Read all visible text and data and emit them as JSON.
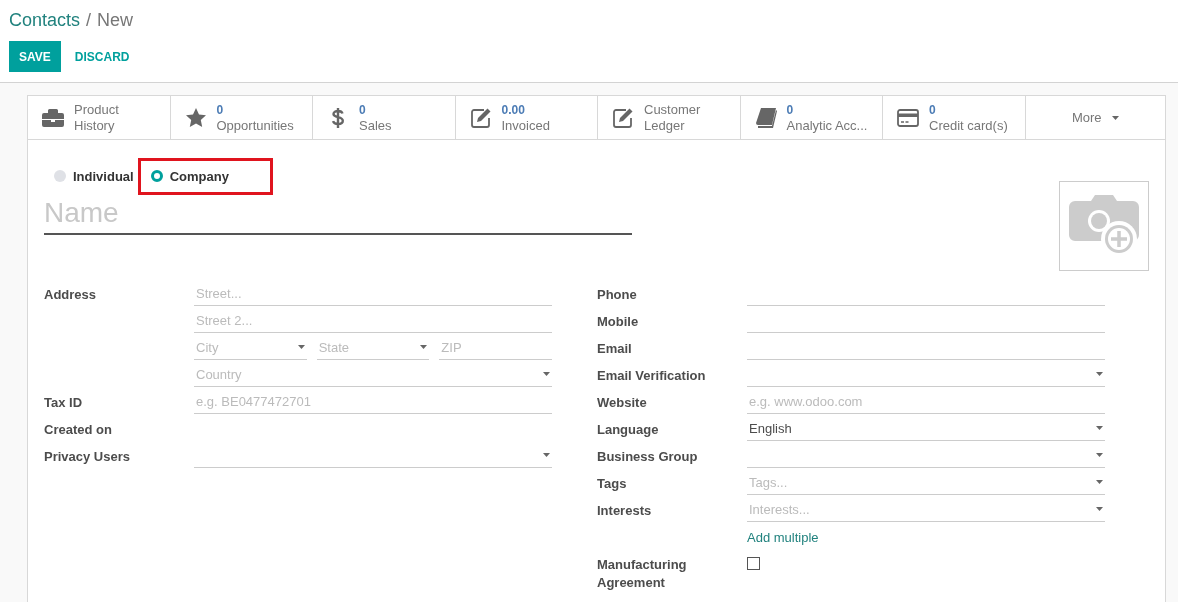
{
  "breadcrumb": {
    "parent": "Contacts",
    "separator": "/",
    "current": "New"
  },
  "buttons": {
    "save": "SAVE",
    "discard": "DISCARD"
  },
  "stat_buttons": [
    {
      "label": "Product History"
    },
    {
      "value": "0",
      "label": "Opportunities"
    },
    {
      "value": "0",
      "label": "Sales"
    },
    {
      "value": "0.00",
      "label": "Invoiced"
    },
    {
      "label": "Customer Ledger"
    },
    {
      "value": "0",
      "label": "Analytic Acc..."
    },
    {
      "value": "0",
      "label": "Credit card(s)"
    }
  ],
  "more_button": "More",
  "company_type": [
    {
      "label": "Individual",
      "selected": false,
      "highlighted": false
    },
    {
      "label": "Company",
      "selected": true,
      "highlighted": true
    }
  ],
  "name_field": {
    "placeholder": "Name"
  },
  "left_fields": [
    {
      "label": "Address",
      "lines": [
        [
          {
            "kind": "input",
            "placeholder": "Street...",
            "dropdown": false
          }
        ],
        [
          {
            "kind": "input",
            "placeholder": "Street 2...",
            "dropdown": false
          }
        ],
        [
          {
            "kind": "input",
            "placeholder": "City",
            "dropdown": true
          },
          {
            "kind": "input",
            "placeholder": "State",
            "dropdown": true
          },
          {
            "kind": "input",
            "placeholder": "ZIP",
            "dropdown": false
          }
        ],
        [
          {
            "kind": "input",
            "placeholder": "Country",
            "dropdown": true
          }
        ]
      ]
    },
    {
      "label": "Tax ID",
      "lines": [
        [
          {
            "kind": "input",
            "placeholder": "e.g. BE0477472701",
            "dropdown": false
          }
        ]
      ]
    },
    {
      "label": "Created on"
    },
    {
      "label": "Privacy Users",
      "lines": [
        [
          {
            "kind": "input",
            "dropdown": true
          }
        ]
      ]
    }
  ],
  "right_fields": [
    {
      "label": "Phone",
      "lines": [
        [
          {
            "kind": "input",
            "dropdown": false
          }
        ]
      ]
    },
    {
      "label": "Mobile",
      "lines": [
        [
          {
            "kind": "input",
            "dropdown": false
          }
        ]
      ]
    },
    {
      "label": "Email",
      "lines": [
        [
          {
            "kind": "input",
            "dropdown": false
          }
        ]
      ]
    },
    {
      "label": "Email Verification",
      "lines": [
        [
          {
            "kind": "input",
            "dropdown": true
          }
        ]
      ]
    },
    {
      "label": "Website",
      "lines": [
        [
          {
            "kind": "input",
            "placeholder": "e.g. www.odoo.com",
            "dropdown": false
          }
        ]
      ]
    },
    {
      "label": "Language",
      "lines": [
        [
          {
            "kind": "input",
            "value": "English",
            "dropdown": true
          }
        ]
      ]
    },
    {
      "label": "Business Group",
      "lines": [
        [
          {
            "kind": "input",
            "dropdown": true
          }
        ]
      ]
    },
    {
      "label": "Tags",
      "lines": [
        [
          {
            "kind": "input",
            "placeholder": "Tags...",
            "dropdown": true
          }
        ]
      ]
    },
    {
      "label": "Interests",
      "lines": [
        [
          {
            "kind": "input",
            "placeholder": "Interests...",
            "dropdown": true
          }
        ],
        [
          {
            "kind": "link",
            "text": "Add multiple"
          }
        ]
      ]
    },
    {
      "label": "Manufacturing Agreement",
      "lines": [
        [
          {
            "kind": "checkbox",
            "checked": false
          }
        ]
      ]
    }
  ]
}
